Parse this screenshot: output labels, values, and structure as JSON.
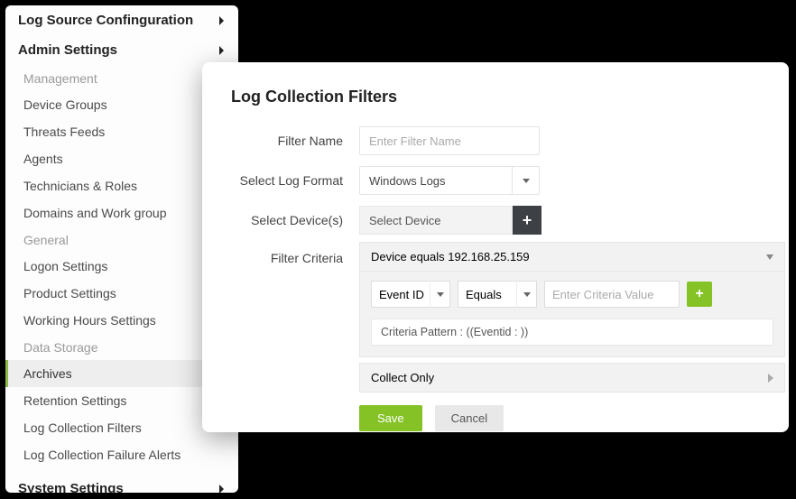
{
  "sidebar": {
    "top": [
      {
        "label": "Log Source Confinguration"
      },
      {
        "label": "Admin Settings"
      }
    ],
    "groups": [
      {
        "header": "Management",
        "items": [
          {
            "label": "Device Groups"
          },
          {
            "label": "Threats Feeds"
          },
          {
            "label": "Agents"
          },
          {
            "label": "Technicians & Roles"
          },
          {
            "label": "Domains and Work group"
          }
        ]
      },
      {
        "header": "General",
        "items": [
          {
            "label": "Logon Settings"
          },
          {
            "label": "Product Settings"
          },
          {
            "label": "Working Hours Settings"
          }
        ]
      },
      {
        "header": "Data Storage",
        "items": [
          {
            "label": "Archives",
            "active": true
          },
          {
            "label": "Retention Settings"
          },
          {
            "label": "Log Collection Filters"
          },
          {
            "label": "Log Collection Failure Alerts"
          }
        ]
      }
    ],
    "bottom": {
      "label": "System Settings"
    }
  },
  "panel": {
    "title": "Log Collection Filters",
    "filter_name_label": "Filter Name",
    "filter_name_placeholder": "Enter Filter Name",
    "filter_name_value": "",
    "log_format_label": "Select Log Format",
    "log_format_value": "Windows Logs",
    "devices_label": "Select Device(s)",
    "devices_value": "Select Device",
    "criteria_label": "Filter Criteria",
    "criteria_header": "Device equals 192.168.25.159",
    "criteria_field": "Event ID",
    "criteria_op": "Equals",
    "criteria_value_placeholder": "Enter Criteria Value",
    "criteria_value": "",
    "pattern_text": "Criteria Pattern : ((Eventid : ))",
    "collect_only": "Collect Only",
    "save": "Save",
    "cancel": "Cancel"
  }
}
